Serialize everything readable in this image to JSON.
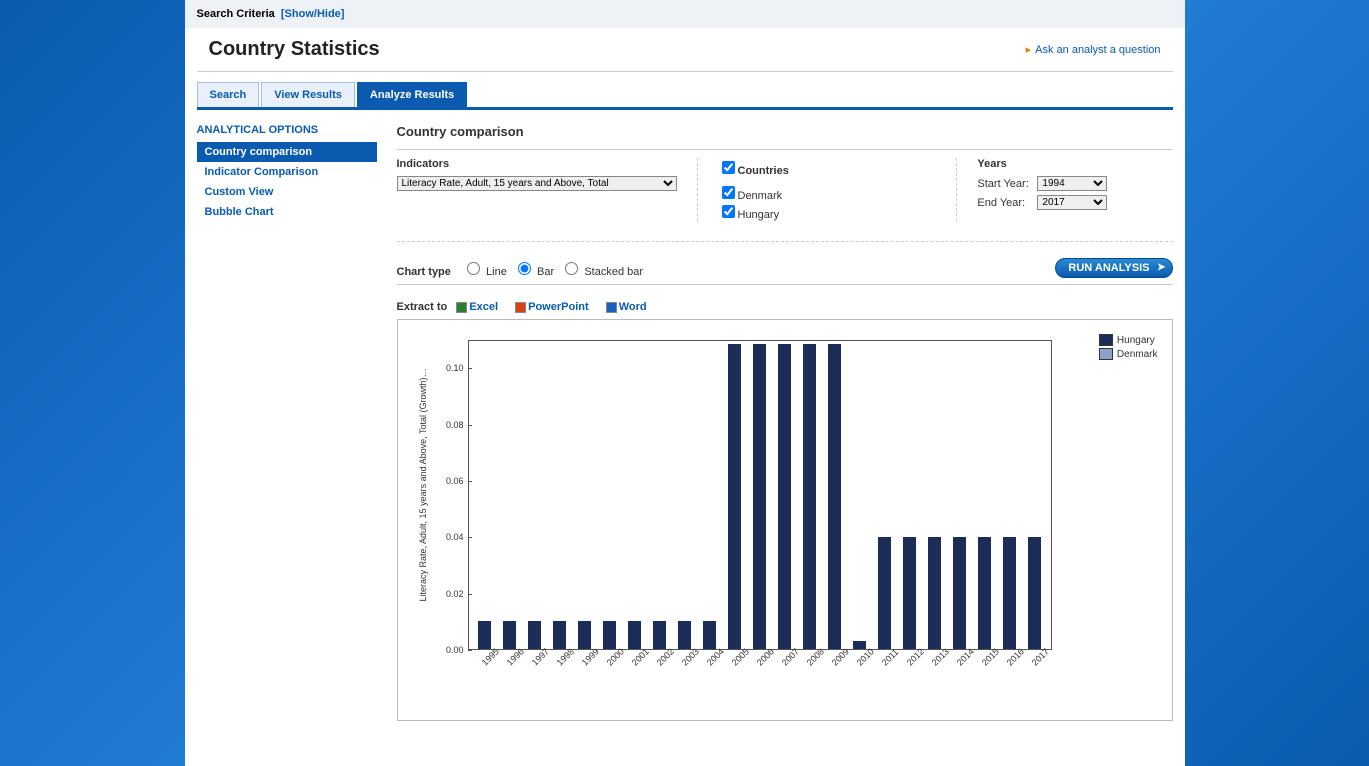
{
  "searchCriteria": {
    "label": "Search Criteria",
    "toggle": "[Show/Hide]"
  },
  "pageTitle": "Country Statistics",
  "askLink": "Ask an analyst a question",
  "tabs": {
    "search": "Search",
    "viewResults": "View Results",
    "analyzeResults": "Analyze Results"
  },
  "sidebar": {
    "heading": "ANALYTICAL OPTIONS",
    "items": [
      "Country comparison",
      "Indicator Comparison",
      "Custom View",
      "Bubble Chart"
    ]
  },
  "panel": {
    "title": "Country comparison",
    "indicators": {
      "label": "Indicators",
      "selected": "Literacy Rate, Adult, 15 years and Above, Total"
    },
    "countries": {
      "label": "Countries",
      "items": [
        "Denmark",
        "Hungary"
      ]
    },
    "years": {
      "label": "Years",
      "startLabel": "Start Year:",
      "start": "1994",
      "endLabel": "End Year:",
      "end": "2017"
    },
    "chartType": {
      "label": "Chart type",
      "line": "Line",
      "bar": "Bar",
      "stacked": "Stacked bar"
    },
    "runButton": "RUN ANALYSIS",
    "extract": {
      "label": "Extract to",
      "excel": "Excel",
      "ppt": "PowerPoint",
      "word": "Word"
    }
  },
  "legend": {
    "hungary": "Hungary",
    "denmark": "Denmark"
  },
  "yAxisLabel": "Literacy Rate, Adult, 15 years and Above, Total (Growth)…",
  "chart_data": {
    "type": "bar",
    "title": "",
    "xlabel": "",
    "ylabel": "Literacy Rate, Adult, 15 years and Above, Total (Growth)…",
    "ylim": [
      0,
      0.11
    ],
    "yticks": [
      0.0,
      0.02,
      0.04,
      0.06,
      0.08,
      0.1
    ],
    "categories": [
      "1995",
      "1996",
      "1997",
      "1998",
      "1999",
      "2000",
      "2001",
      "2002",
      "2003",
      "2004",
      "2005",
      "2006",
      "2007",
      "2008",
      "2009",
      "2010",
      "2011",
      "2012",
      "2013",
      "2014",
      "2015",
      "2016",
      "2017"
    ],
    "series": [
      {
        "name": "Hungary",
        "color": "#1c2e58",
        "values": [
          0.01,
          0.01,
          0.01,
          0.01,
          0.01,
          0.01,
          0.01,
          0.01,
          0.01,
          0.01,
          0.109,
          0.109,
          0.109,
          0.109,
          0.109,
          0.003,
          0.04,
          0.04,
          0.04,
          0.04,
          0.04,
          0.04,
          0.04
        ]
      },
      {
        "name": "Denmark",
        "color": "#8ea0cc",
        "values": [
          0,
          0,
          0,
          0,
          0,
          0,
          0,
          0,
          0,
          0,
          0,
          0,
          0,
          0,
          0,
          0,
          0,
          0,
          0,
          0,
          0,
          0,
          0
        ]
      }
    ]
  }
}
